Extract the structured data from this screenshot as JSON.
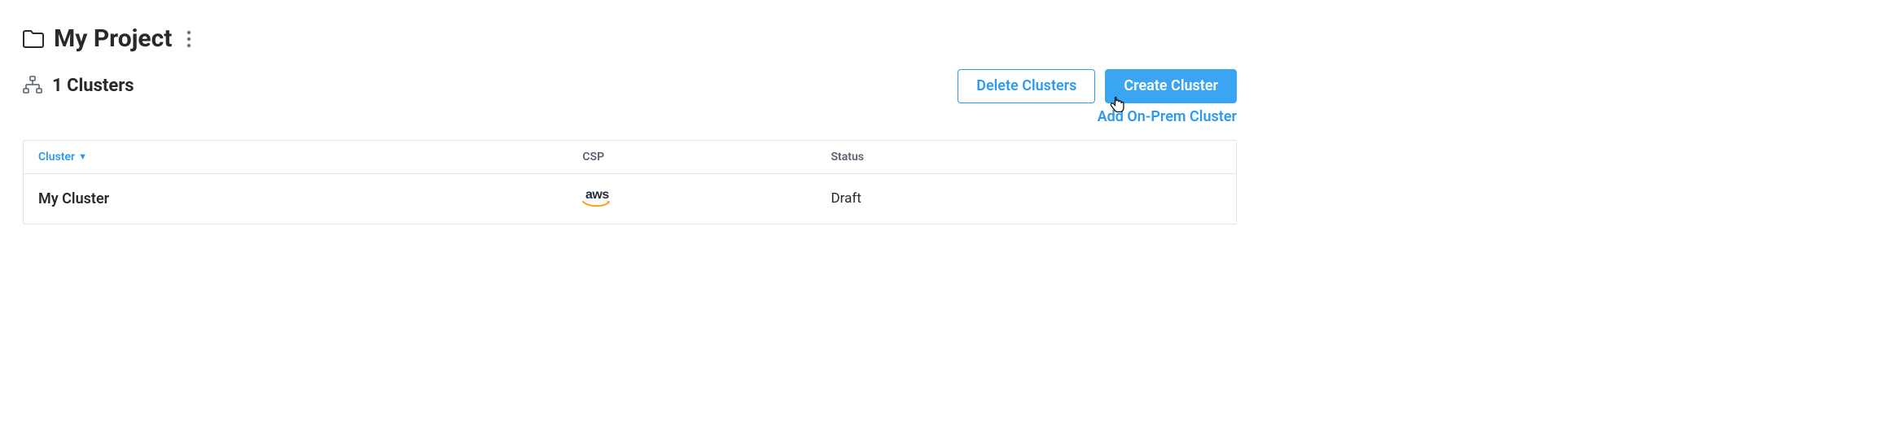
{
  "header": {
    "title": "My Project"
  },
  "sub": {
    "count_label": "1 Clusters"
  },
  "actions": {
    "delete_label": "Delete Clusters",
    "create_label": "Create Cluster",
    "add_onprem_label": "Add On-Prem Cluster"
  },
  "table": {
    "headers": {
      "cluster": "Cluster",
      "csp": "CSP",
      "status": "Status"
    },
    "rows": [
      {
        "cluster": "My Cluster",
        "csp": "aws",
        "status": "Draft"
      }
    ]
  }
}
